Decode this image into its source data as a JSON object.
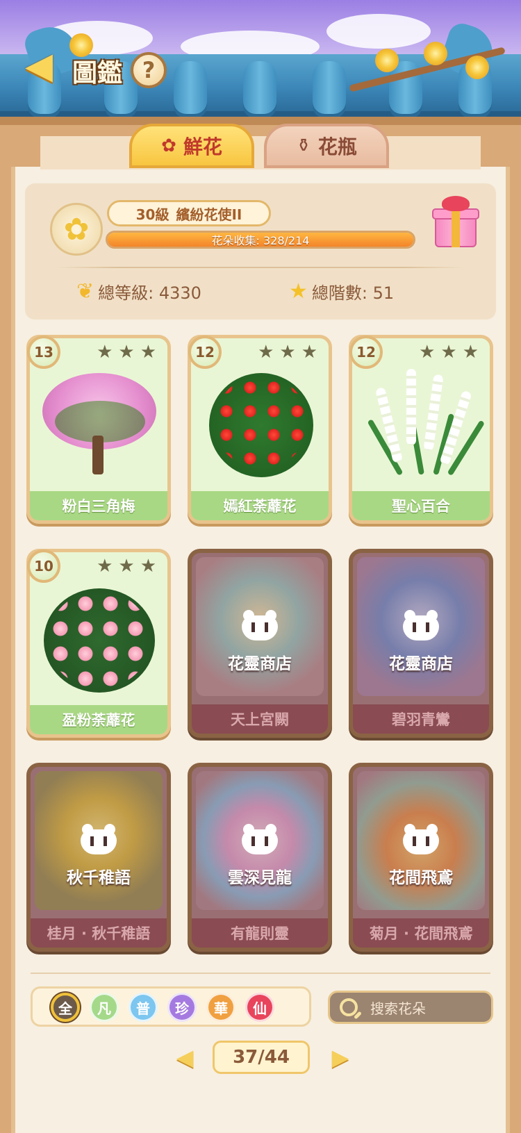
{
  "header": {
    "title": "圖鑑",
    "help_label": "?"
  },
  "tabs": [
    {
      "label": "鮮花",
      "icon": "rose-icon",
      "active": true
    },
    {
      "label": "花瓶",
      "icon": "vase-icon",
      "active": false
    }
  ],
  "summary": {
    "level": "30級",
    "rank_title": "繽紛花使II",
    "collection_text": "花朵收集: 328/214",
    "collection_progress": 1.0,
    "total_level_label": "總等級: 4330",
    "total_rank_label": "總階數: 51"
  },
  "cards": [
    {
      "name": "粉白三角梅",
      "level": "13",
      "locked": false,
      "stars": 3
    },
    {
      "name": "嫣紅荼蘼花",
      "level": "12",
      "locked": false,
      "stars": 3
    },
    {
      "name": "聖心百合",
      "level": "12",
      "locked": false,
      "stars": 3
    },
    {
      "name": "盈粉荼蘼花",
      "level": "10",
      "locked": false,
      "stars": 3
    },
    {
      "name": "天上宮闕",
      "locked": true,
      "source": "花靈商店"
    },
    {
      "name": "碧羽青鸞",
      "locked": true,
      "source": "花靈商店"
    },
    {
      "name": "桂月 · 秋千稚語",
      "locked": true,
      "source": "秋千稚語"
    },
    {
      "name": "有龍則靈",
      "locked": true,
      "source": "雲深見龍"
    },
    {
      "name": "菊月 · 花間飛鳶",
      "locked": true,
      "source": "花間飛鳶"
    }
  ],
  "filters": [
    {
      "label": "全",
      "color": "#6b5a4a",
      "active": true
    },
    {
      "label": "凡",
      "color": "#a5d98a",
      "active": false
    },
    {
      "label": "普",
      "color": "#7cc6ef",
      "active": false
    },
    {
      "label": "珍",
      "color": "#a57ae0",
      "active": false
    },
    {
      "label": "華",
      "color": "#f0a040",
      "active": false
    },
    {
      "label": "仙",
      "color": "#e8445c",
      "active": false
    }
  ],
  "search": {
    "placeholder": "搜索花朵"
  },
  "pager": {
    "text": "37/44",
    "prev": "◀",
    "next": "▶"
  }
}
